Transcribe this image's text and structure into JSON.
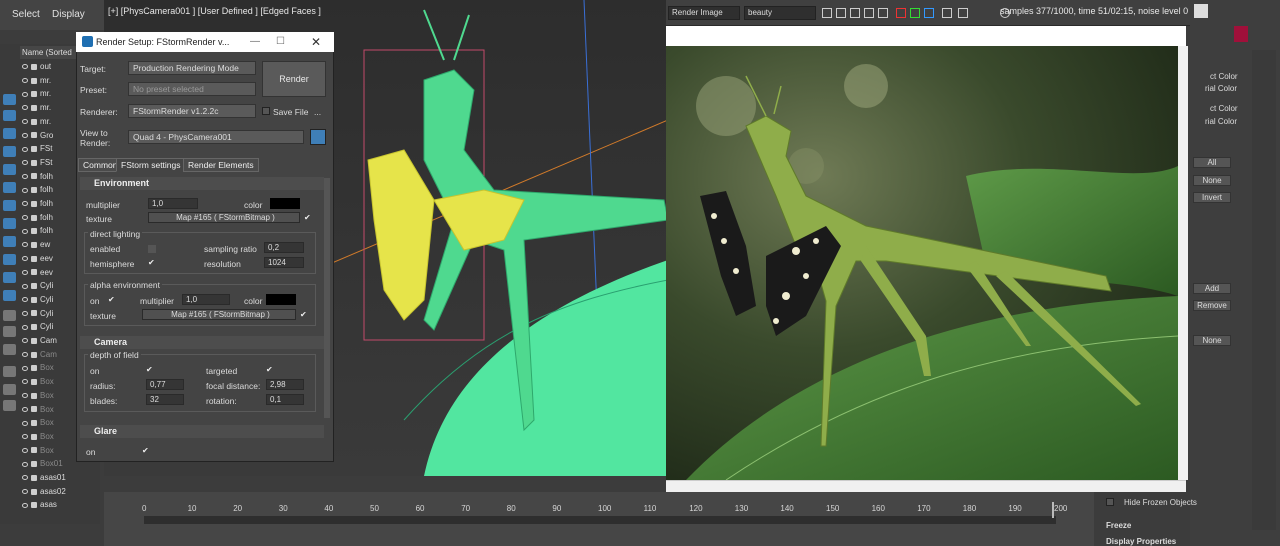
{
  "menu": {
    "select": "Select",
    "display": "Display"
  },
  "explorer": {
    "header": "Name (Sorted",
    "rows": [
      "out",
      "mr.",
      "mr.",
      "mr.",
      "mr.",
      "Gro",
      "FSt",
      "FSt",
      "folh",
      "folh",
      "folh",
      "folh",
      "folh",
      "ew",
      "eev",
      "eev",
      "Cyli",
      "Cyli",
      "Cyli",
      "Cyli",
      "Cam",
      "Cam",
      "Box",
      "Box",
      "Box",
      "Box",
      "Box",
      "Box",
      "Box",
      "Box01",
      "asas01",
      "asas02",
      "asas"
    ]
  },
  "viewport": {
    "label": "[+] [PhysCamera001 ] [User Defined ] [Edged Faces ]"
  },
  "render_window": {
    "title_dropdown": "Render Image",
    "channel_dropdown": "beauty",
    "status": "samples 377/1000, time 51/02:15, noise level 0"
  },
  "dialog": {
    "title": "Render Setup: FStormRender v...",
    "target_label": "Target:",
    "target_value": "Production Rendering Mode",
    "preset_label": "Preset:",
    "preset_value": "No preset selected",
    "renderer_label": "Renderer:",
    "renderer_value": "FStormRender v1.2.2c",
    "save_file": "Save File",
    "more": "...",
    "view_label_1": "View to",
    "view_label_2": "Render:",
    "view_value": "Quad 4 - PhysCamera001",
    "render_button": "Render",
    "tabs": [
      "Common",
      "FStorm settings",
      "Render Elements"
    ],
    "environment": {
      "heading": "Environment",
      "multiplier_label": "multiplier",
      "multiplier_value": "1,0",
      "color_label": "color",
      "texture_label": "texture",
      "texture_value": "Map #165  ( FStormBitmap )",
      "direct_lighting": "direct lighting",
      "enabled": "enabled",
      "sampling_ratio": "sampling ratio",
      "sampling_ratio_value": "0,2",
      "hemisphere": "hemisphere",
      "resolution": "resolution",
      "resolution_value": "1024",
      "alpha_environment": "alpha environment",
      "on": "on",
      "alpha_multiplier": "multiplier",
      "alpha_multiplier_value": "1,0",
      "alpha_color": "color",
      "alpha_texture": "texture",
      "alpha_texture_value": "Map #165  ( FStormBitmap )"
    },
    "camera": {
      "heading": "Camera",
      "dof": "depth of field",
      "on": "on",
      "targeted": "targeted",
      "radius_label": "radius:",
      "radius_value": "0,77",
      "focal_label": "focal distance:",
      "focal_value": "2,98",
      "blades_label": "blades:",
      "blades_value": "32",
      "rotation_label": "rotation:",
      "rotation_value": "0,1"
    },
    "glare": {
      "heading": "Glare",
      "on": "on"
    }
  },
  "right_panel": {
    "obj_color_1": "ct Color",
    "mat_color_1": "rial Color",
    "obj_color_2": "ct Color",
    "mat_color_2": "rial Color",
    "all": "All",
    "none": "None",
    "invert": "Invert",
    "add": "Add",
    "remove": "Remove",
    "none2": "None",
    "hide_frozen": "Hide Frozen Objects",
    "freeze": "Freeze",
    "display_properties": "Display Properties"
  },
  "timeline": {
    "ticks": [
      "0",
      "10",
      "20",
      "30",
      "40",
      "50",
      "60",
      "70",
      "80",
      "90",
      "100",
      "110",
      "120",
      "130",
      "140",
      "150",
      "160",
      "170",
      "180",
      "190",
      "200"
    ]
  },
  "colors": {
    "accent": "#3f7fb8",
    "swatch": "#000000",
    "mesh": "#52e6a0",
    "wing": "#e8e84a"
  }
}
